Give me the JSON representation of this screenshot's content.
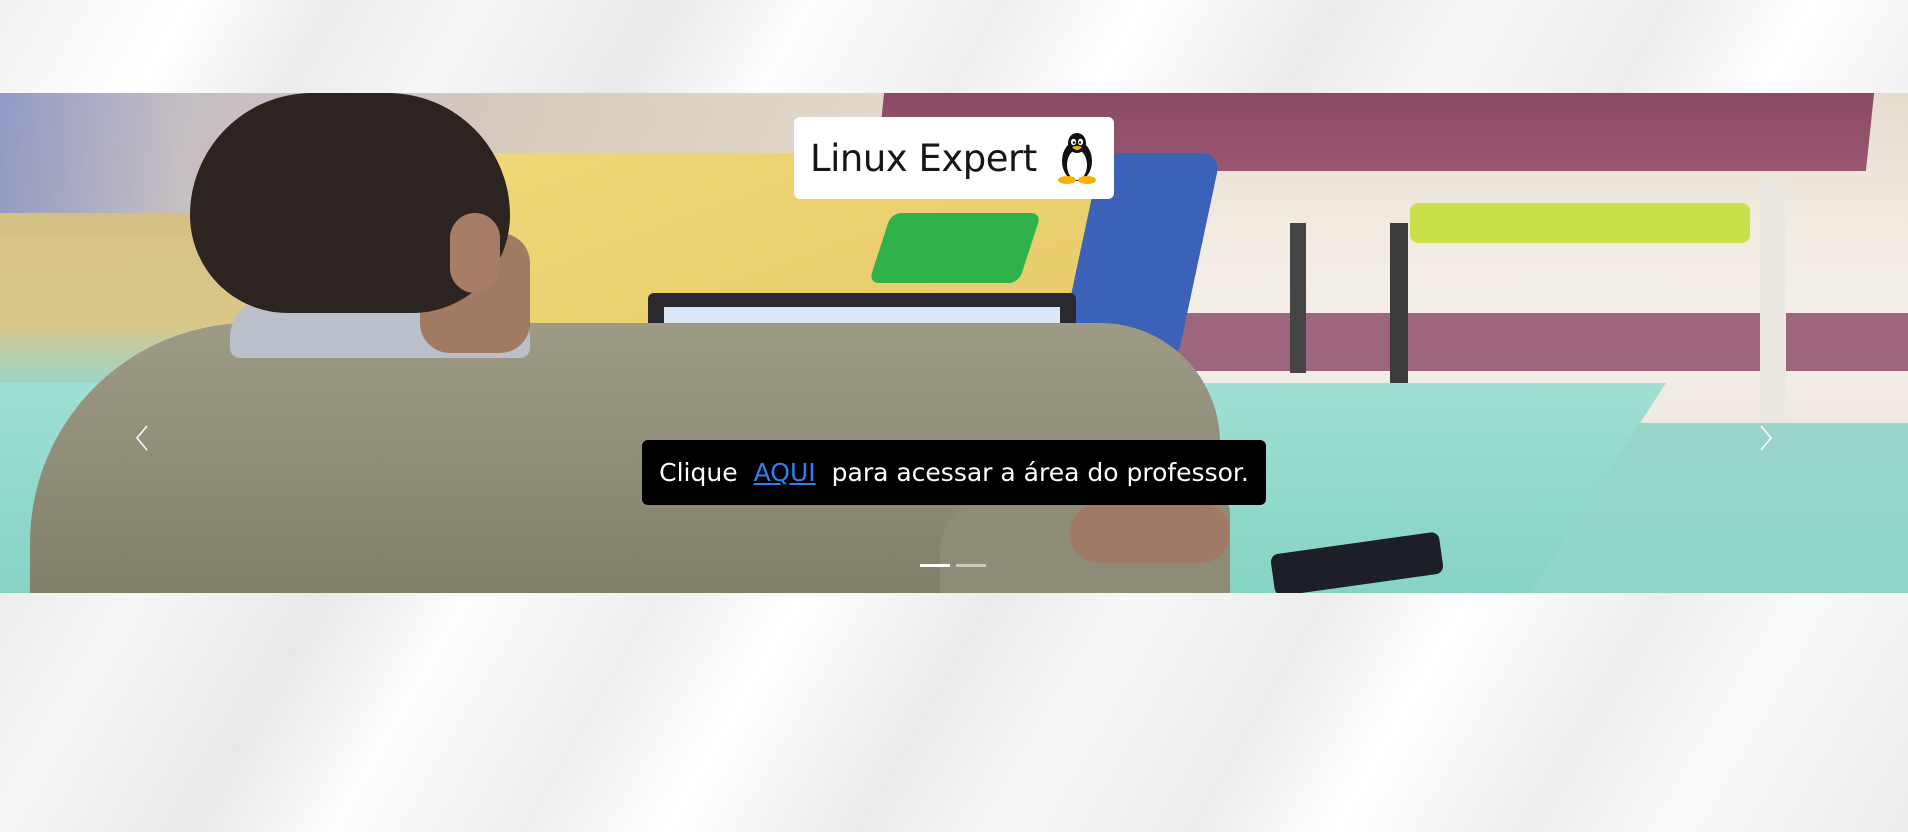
{
  "hero": {
    "title": "Linux Expert",
    "logo_icon": "tux-penguin-icon",
    "caption": {
      "prefix": "Clique",
      "link_text": "AQUI",
      "suffix": "para acessar a área do professor."
    }
  },
  "carousel": {
    "prev_icon": "chevron-left-icon",
    "next_icon": "chevron-right-icon",
    "slide_count": 2,
    "active_slide": 1
  },
  "colors": {
    "link": "#2f7ff0",
    "caption_bg": "#000000",
    "title_bg": "#ffffff"
  }
}
